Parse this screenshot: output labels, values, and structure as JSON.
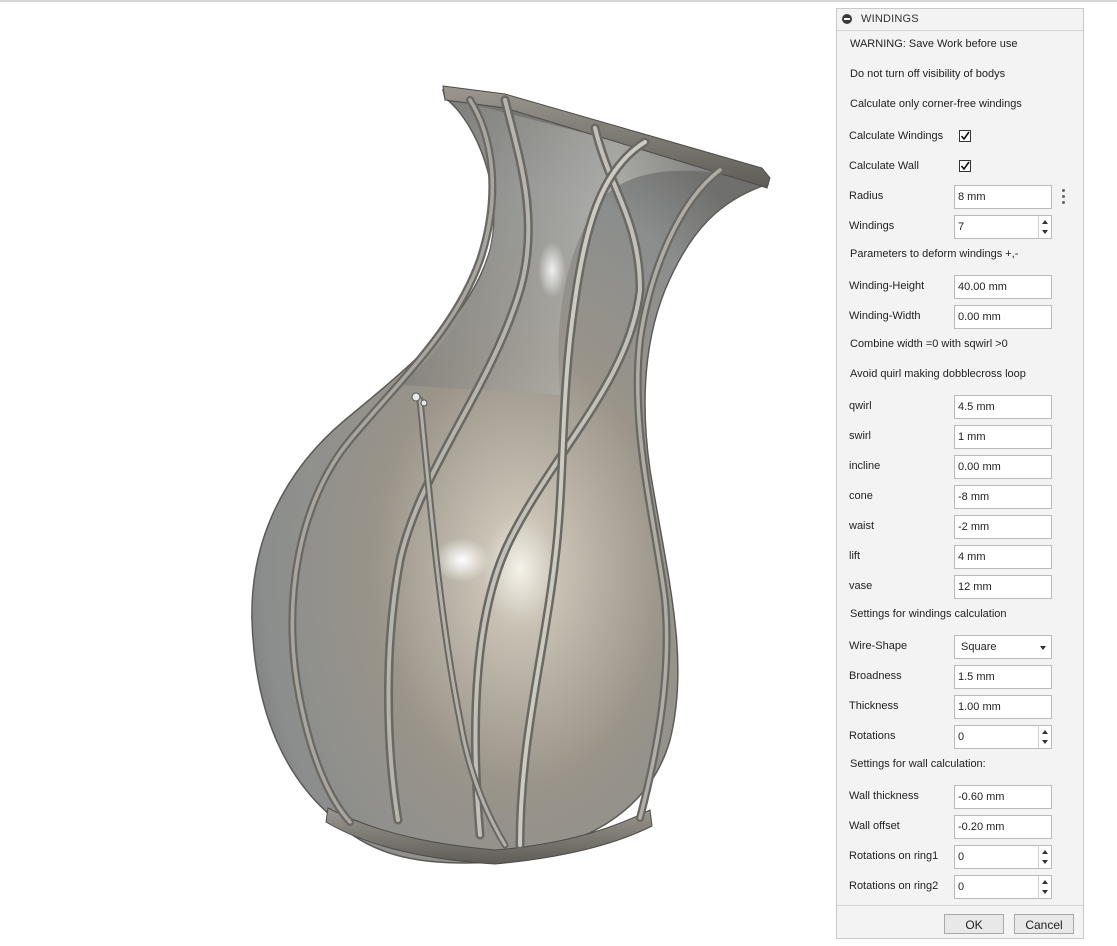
{
  "panel": {
    "title": "WINDINGS",
    "notes": {
      "warning": "WARNING: Save Work before use",
      "visibility": "Do not turn off visibility of bodys",
      "corner_free": "Calculate only corner-free windings",
      "deform": "Parameters to deform windings +,-",
      "combine": "Combine width =0 with sqwirl >0",
      "avoid": "Avoid quirl making dobblecross loop",
      "settings_windings": "Settings for windings calculation",
      "settings_wall": "Settings for wall calculation:"
    },
    "checks": {
      "calc_windings_label": "Calculate Windings",
      "calc_windings_checked": true,
      "calc_wall_label": "Calculate Wall",
      "calc_wall_checked": true
    },
    "fields": {
      "radius": {
        "label": "Radius",
        "value": "8 mm"
      },
      "windings": {
        "label": "Windings",
        "value": "7"
      },
      "winding_height": {
        "label": "Winding-Height",
        "value": "40.00 mm"
      },
      "winding_width": {
        "label": "Winding-Width",
        "value": "0.00 mm"
      },
      "qwirl": {
        "label": "qwirl",
        "value": "4.5 mm"
      },
      "swirl": {
        "label": "swirl",
        "value": "1 mm"
      },
      "incline": {
        "label": "incline",
        "value": "0.00 mm"
      },
      "cone": {
        "label": "cone",
        "value": "-8 mm"
      },
      "waist": {
        "label": "waist",
        "value": "-2 mm"
      },
      "lift": {
        "label": "lift",
        "value": "4 mm"
      },
      "vase": {
        "label": "vase",
        "value": "12 mm"
      },
      "wire_shape": {
        "label": "Wire-Shape",
        "value": "Square"
      },
      "broadness": {
        "label": "Broadness",
        "value": "1.5 mm"
      },
      "thickness": {
        "label": "Thickness",
        "value": "1.00 mm"
      },
      "rotations": {
        "label": "Rotations",
        "value": "0"
      },
      "wall_thickness": {
        "label": "Wall thickness",
        "value": "-0.60 mm"
      },
      "wall_offset": {
        "label": "Wall offset",
        "value": "-0.20 mm"
      },
      "rot_ring1": {
        "label": "Rotations on ring1",
        "value": "0"
      },
      "rot_ring2": {
        "label": "Rotations on ring2",
        "value": "0"
      }
    },
    "buttons": {
      "ok": "OK",
      "cancel": "Cancel"
    }
  },
  "icons": {
    "collapse": "collapse-icon",
    "menu": "kebab-menu-icon",
    "checkbox": "checkmark-icon"
  },
  "colors": {
    "panel_bg": "#f3f3f3",
    "vase_metal": "#8e8b86"
  }
}
